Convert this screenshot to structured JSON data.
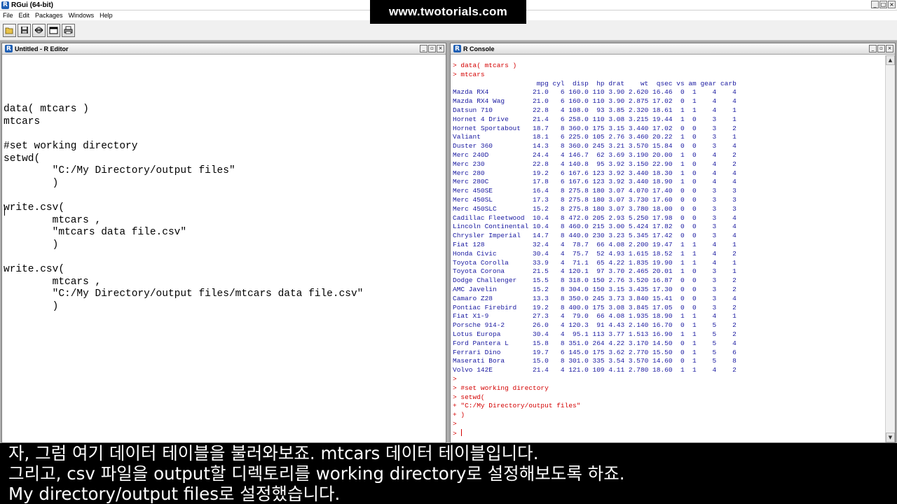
{
  "app": {
    "title": "RGui (64-bit)"
  },
  "menubar": [
    "File",
    "Edit",
    "Packages",
    "Windows",
    "Help"
  ],
  "toolbar": {
    "icons": [
      "open-folder-icon",
      "save-icon",
      "return-to-console-icon",
      "window-icon",
      "print-icon"
    ]
  },
  "watermark": "www.twotorials.com",
  "editor": {
    "title": "Untitled - R Editor",
    "lines": [
      "data( mtcars )",
      "mtcars",
      "",
      "#set working directory",
      "setwd(",
      "        \"C:/My Directory/output files\"",
      "        )",
      "",
      "write.csv(",
      "        mtcars ,",
      "        \"mtcars data file.csv\"",
      "        )",
      "",
      "write.csv(",
      "        mtcars ,",
      "        \"C:/My Directory/output files/mtcars data file.csv\"",
      "        )"
    ]
  },
  "console": {
    "title": "R Console",
    "commands_top": [
      "> data( mtcars )",
      "> mtcars"
    ],
    "table_header": "                     mpg cyl  disp  hp drat    wt  qsec vs am gear carb",
    "table_rows": [
      "Mazda RX4           21.0   6 160.0 110 3.90 2.620 16.46  0  1    4    4",
      "Mazda RX4 Wag       21.0   6 160.0 110 3.90 2.875 17.02  0  1    4    4",
      "Datsun 710          22.8   4 108.0  93 3.85 2.320 18.61  1  1    4    1",
      "Hornet 4 Drive      21.4   6 258.0 110 3.08 3.215 19.44  1  0    3    1",
      "Hornet Sportabout   18.7   8 360.0 175 3.15 3.440 17.02  0  0    3    2",
      "Valiant             18.1   6 225.0 105 2.76 3.460 20.22  1  0    3    1",
      "Duster 360          14.3   8 360.0 245 3.21 3.570 15.84  0  0    3    4",
      "Merc 240D           24.4   4 146.7  62 3.69 3.190 20.00  1  0    4    2",
      "Merc 230            22.8   4 140.8  95 3.92 3.150 22.90  1  0    4    2",
      "Merc 280            19.2   6 167.6 123 3.92 3.440 18.30  1  0    4    4",
      "Merc 280C           17.8   6 167.6 123 3.92 3.440 18.90  1  0    4    4",
      "Merc 450SE          16.4   8 275.8 180 3.07 4.070 17.40  0  0    3    3",
      "Merc 450SL          17.3   8 275.8 180 3.07 3.730 17.60  0  0    3    3",
      "Merc 450SLC         15.2   8 275.8 180 3.07 3.780 18.00  0  0    3    3",
      "Cadillac Fleetwood  10.4   8 472.0 205 2.93 5.250 17.98  0  0    3    4",
      "Lincoln Continental 10.4   8 460.0 215 3.00 5.424 17.82  0  0    3    4",
      "Chrysler Imperial   14.7   8 440.0 230 3.23 5.345 17.42  0  0    3    4",
      "Fiat 128            32.4   4  78.7  66 4.08 2.200 19.47  1  1    4    1",
      "Honda Civic         30.4   4  75.7  52 4.93 1.615 18.52  1  1    4    2",
      "Toyota Corolla      33.9   4  71.1  65 4.22 1.835 19.90  1  1    4    1",
      "Toyota Corona       21.5   4 120.1  97 3.70 2.465 20.01  1  0    3    1",
      "Dodge Challenger    15.5   8 318.0 150 2.76 3.520 16.87  0  0    3    2",
      "AMC Javelin         15.2   8 304.0 150 3.15 3.435 17.30  0  0    3    2",
      "Camaro Z28          13.3   8 350.0 245 3.73 3.840 15.41  0  0    3    4",
      "Pontiac Firebird    19.2   8 400.0 175 3.08 3.845 17.05  0  0    3    2",
      "Fiat X1-9           27.3   4  79.0  66 4.08 1.935 18.90  1  1    4    1",
      "Porsche 914-2       26.0   4 120.3  91 4.43 2.140 16.70  0  1    5    2",
      "Lotus Europa        30.4   4  95.1 113 3.77 1.513 16.90  1  1    5    2",
      "Ford Pantera L      15.8   8 351.0 264 4.22 3.170 14.50  0  1    5    4",
      "Ferrari Dino        19.7   6 145.0 175 3.62 2.770 15.50  0  1    5    6",
      "Maserati Bora       15.0   8 301.0 335 3.54 3.570 14.60  0  1    5    8",
      "Volvo 142E          21.4   4 121.0 109 4.11 2.780 18.60  1  1    4    2"
    ],
    "commands_bottom": [
      ">",
      "> #set working directory",
      "> setwd(",
      "+ \"C:/My Directory/output files\"",
      "+ )",
      ">",
      "> "
    ]
  },
  "subtitles": [
    "자, 그럼 여기 데이터 테이블을 불러와보죠. mtcars 데이터 테이블입니다.",
    "그리고, csv 파일을 output할 디렉토리를 working directory로 설정해보도록 하죠.",
    "My directory/output files로 설정했습니다."
  ],
  "colors": {
    "console_input": "#d40000",
    "console_output": "#1a1aa0",
    "mdi_background": "#ababab",
    "subtitle_background": "#000000"
  }
}
